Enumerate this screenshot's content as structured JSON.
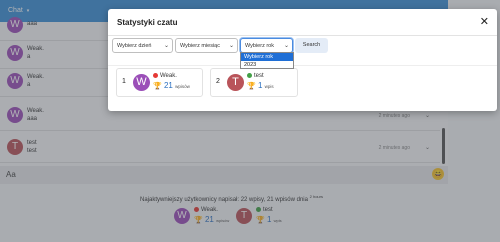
{
  "background": {
    "header_title": "Chat",
    "header_caret": "▾",
    "messages": [
      {
        "initial": "W",
        "name": "",
        "text": "aaa",
        "time": "",
        "color": "#9b4fb8"
      },
      {
        "initial": "W",
        "name": "Weak.",
        "text": "a",
        "time": "",
        "color": "#9b4fb8"
      },
      {
        "initial": "W",
        "name": "Weak.",
        "text": "a",
        "time": "",
        "color": "#9b4fb8"
      },
      {
        "initial": "W",
        "name": "Weak.",
        "text": "aaa",
        "time": "2 minutes ago",
        "color": "#9b4fb8"
      },
      {
        "initial": "T",
        "name": "test",
        "text": "test",
        "time": "2 minutes ago",
        "color": "#b9545a"
      }
    ],
    "input_text": "Aa",
    "emoji": "😄",
    "footer_text": "Najaktywniejszy użytkownicy napisał: 22 wpisy, 21 wpisów dnia",
    "footer_small": "2 hours",
    "footer_users": [
      {
        "initial": "W",
        "name": "Weak.",
        "count": "21",
        "count_label": "wpisów",
        "color": "#9b4fb8"
      },
      {
        "initial": "T",
        "name": "test",
        "count": "1",
        "count_label": "wpis",
        "color": "#b9545a"
      }
    ]
  },
  "modal": {
    "title": "Statystyki czatu",
    "close_label": "✕",
    "filters": {
      "day": {
        "value": "Wybierz dzień"
      },
      "month": {
        "value": "Wybierz miesiąc"
      },
      "year": {
        "value": "Wybierz rok",
        "options": [
          "Wybierz rok",
          "2023"
        ]
      }
    },
    "search_label": "Search",
    "ranking": [
      {
        "rank": "1",
        "initial": "W",
        "name": "Weak.",
        "status": "red",
        "count": "21",
        "count_label": "wpisów",
        "color": "#9b4fb8"
      },
      {
        "rank": "2",
        "initial": "T",
        "name": "test",
        "status": "green",
        "count": "1",
        "count_label": "wpis",
        "color": "#b9545a"
      }
    ]
  },
  "colors": {
    "accent": "#3d8fd6",
    "selected_option": "#1f6fd6",
    "count_text": "#2a6fbf"
  },
  "icons": {
    "trophy": "trophy-icon",
    "close": "close-icon",
    "dropdown_arrow": "chevron-down-icon"
  }
}
